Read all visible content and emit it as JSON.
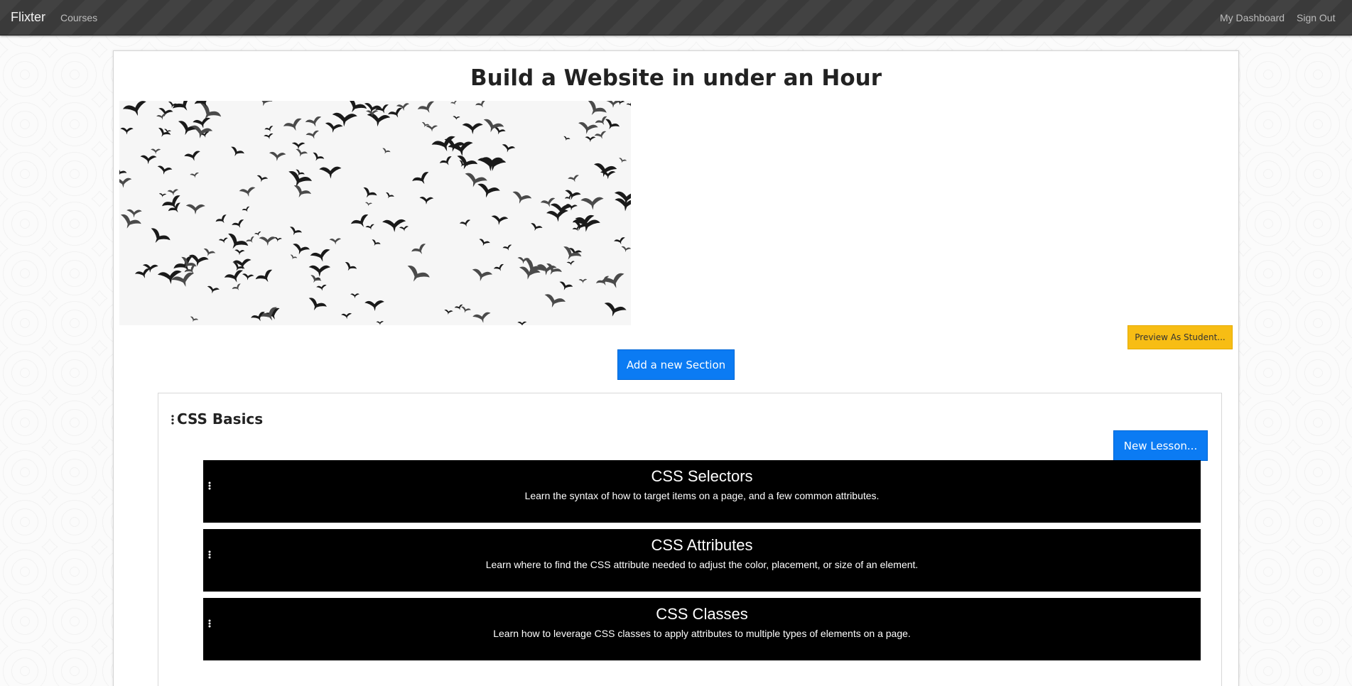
{
  "navbar": {
    "brand": "Flixter",
    "courses": "Courses",
    "dashboard": "My Dashboard",
    "sign_out": "Sign Out"
  },
  "course": {
    "title": "Build a Website in under an Hour",
    "image_subject": "flock of birds"
  },
  "buttons": {
    "preview": "Preview As Student...",
    "add_section": "Add a new Section",
    "new_lesson": "New Lesson..."
  },
  "section": {
    "title": "CSS Basics",
    "lessons": [
      {
        "title": "CSS Selectors",
        "description": "Learn the syntax of how to target items on a page, and a few common attributes."
      },
      {
        "title": "CSS Attributes",
        "description": "Learn where to find the CSS attribute needed to adjust the color, placement, or size of an element."
      },
      {
        "title": "CSS Classes",
        "description": "Learn how to leverage CSS classes to apply attributes to multiple types of elements on a page."
      }
    ]
  },
  "colors": {
    "navbar_bg": "#3a3a3a",
    "primary_button": "#0b7bf3",
    "warning_button": "#f7bd14",
    "lesson_bg": "#000000"
  }
}
